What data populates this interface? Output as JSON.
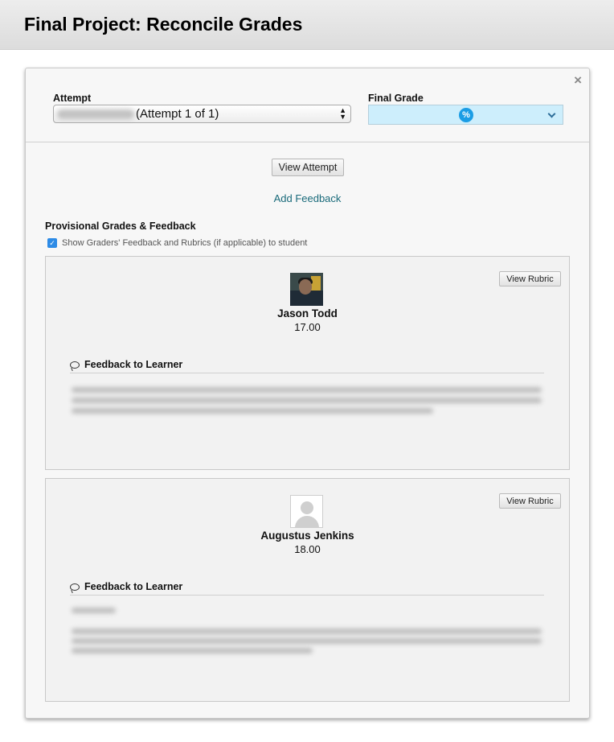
{
  "page": {
    "title": "Final Project: Reconcile Grades"
  },
  "dialog": {
    "close_glyph": "×",
    "attempt": {
      "label": "Attempt",
      "value_suffix": "(Attempt 1 of 1)"
    },
    "final_grade": {
      "label": "Final Grade",
      "icon": "%"
    },
    "view_attempt_label": "View Attempt",
    "add_feedback_label": "Add Feedback",
    "provisional_heading": "Provisional Grades & Feedback",
    "show_feedback_checkbox": {
      "checked": true,
      "label": "Show Graders' Feedback and Rubrics (if applicable) to student"
    },
    "graders": [
      {
        "name": "Jason Todd",
        "score": "17.00",
        "view_rubric_label": "View Rubric",
        "feedback_heading": "Feedback to Learner",
        "avatar": "photo"
      },
      {
        "name": "Augustus Jenkins",
        "score": "18.00",
        "view_rubric_label": "View Rubric",
        "feedback_heading": "Feedback to Learner",
        "avatar": "default-user-icon"
      }
    ]
  },
  "colors": {
    "accent_link": "#196a7a",
    "final_grade_bg": "#cdeefc",
    "checkbox": "#2d8be6"
  }
}
